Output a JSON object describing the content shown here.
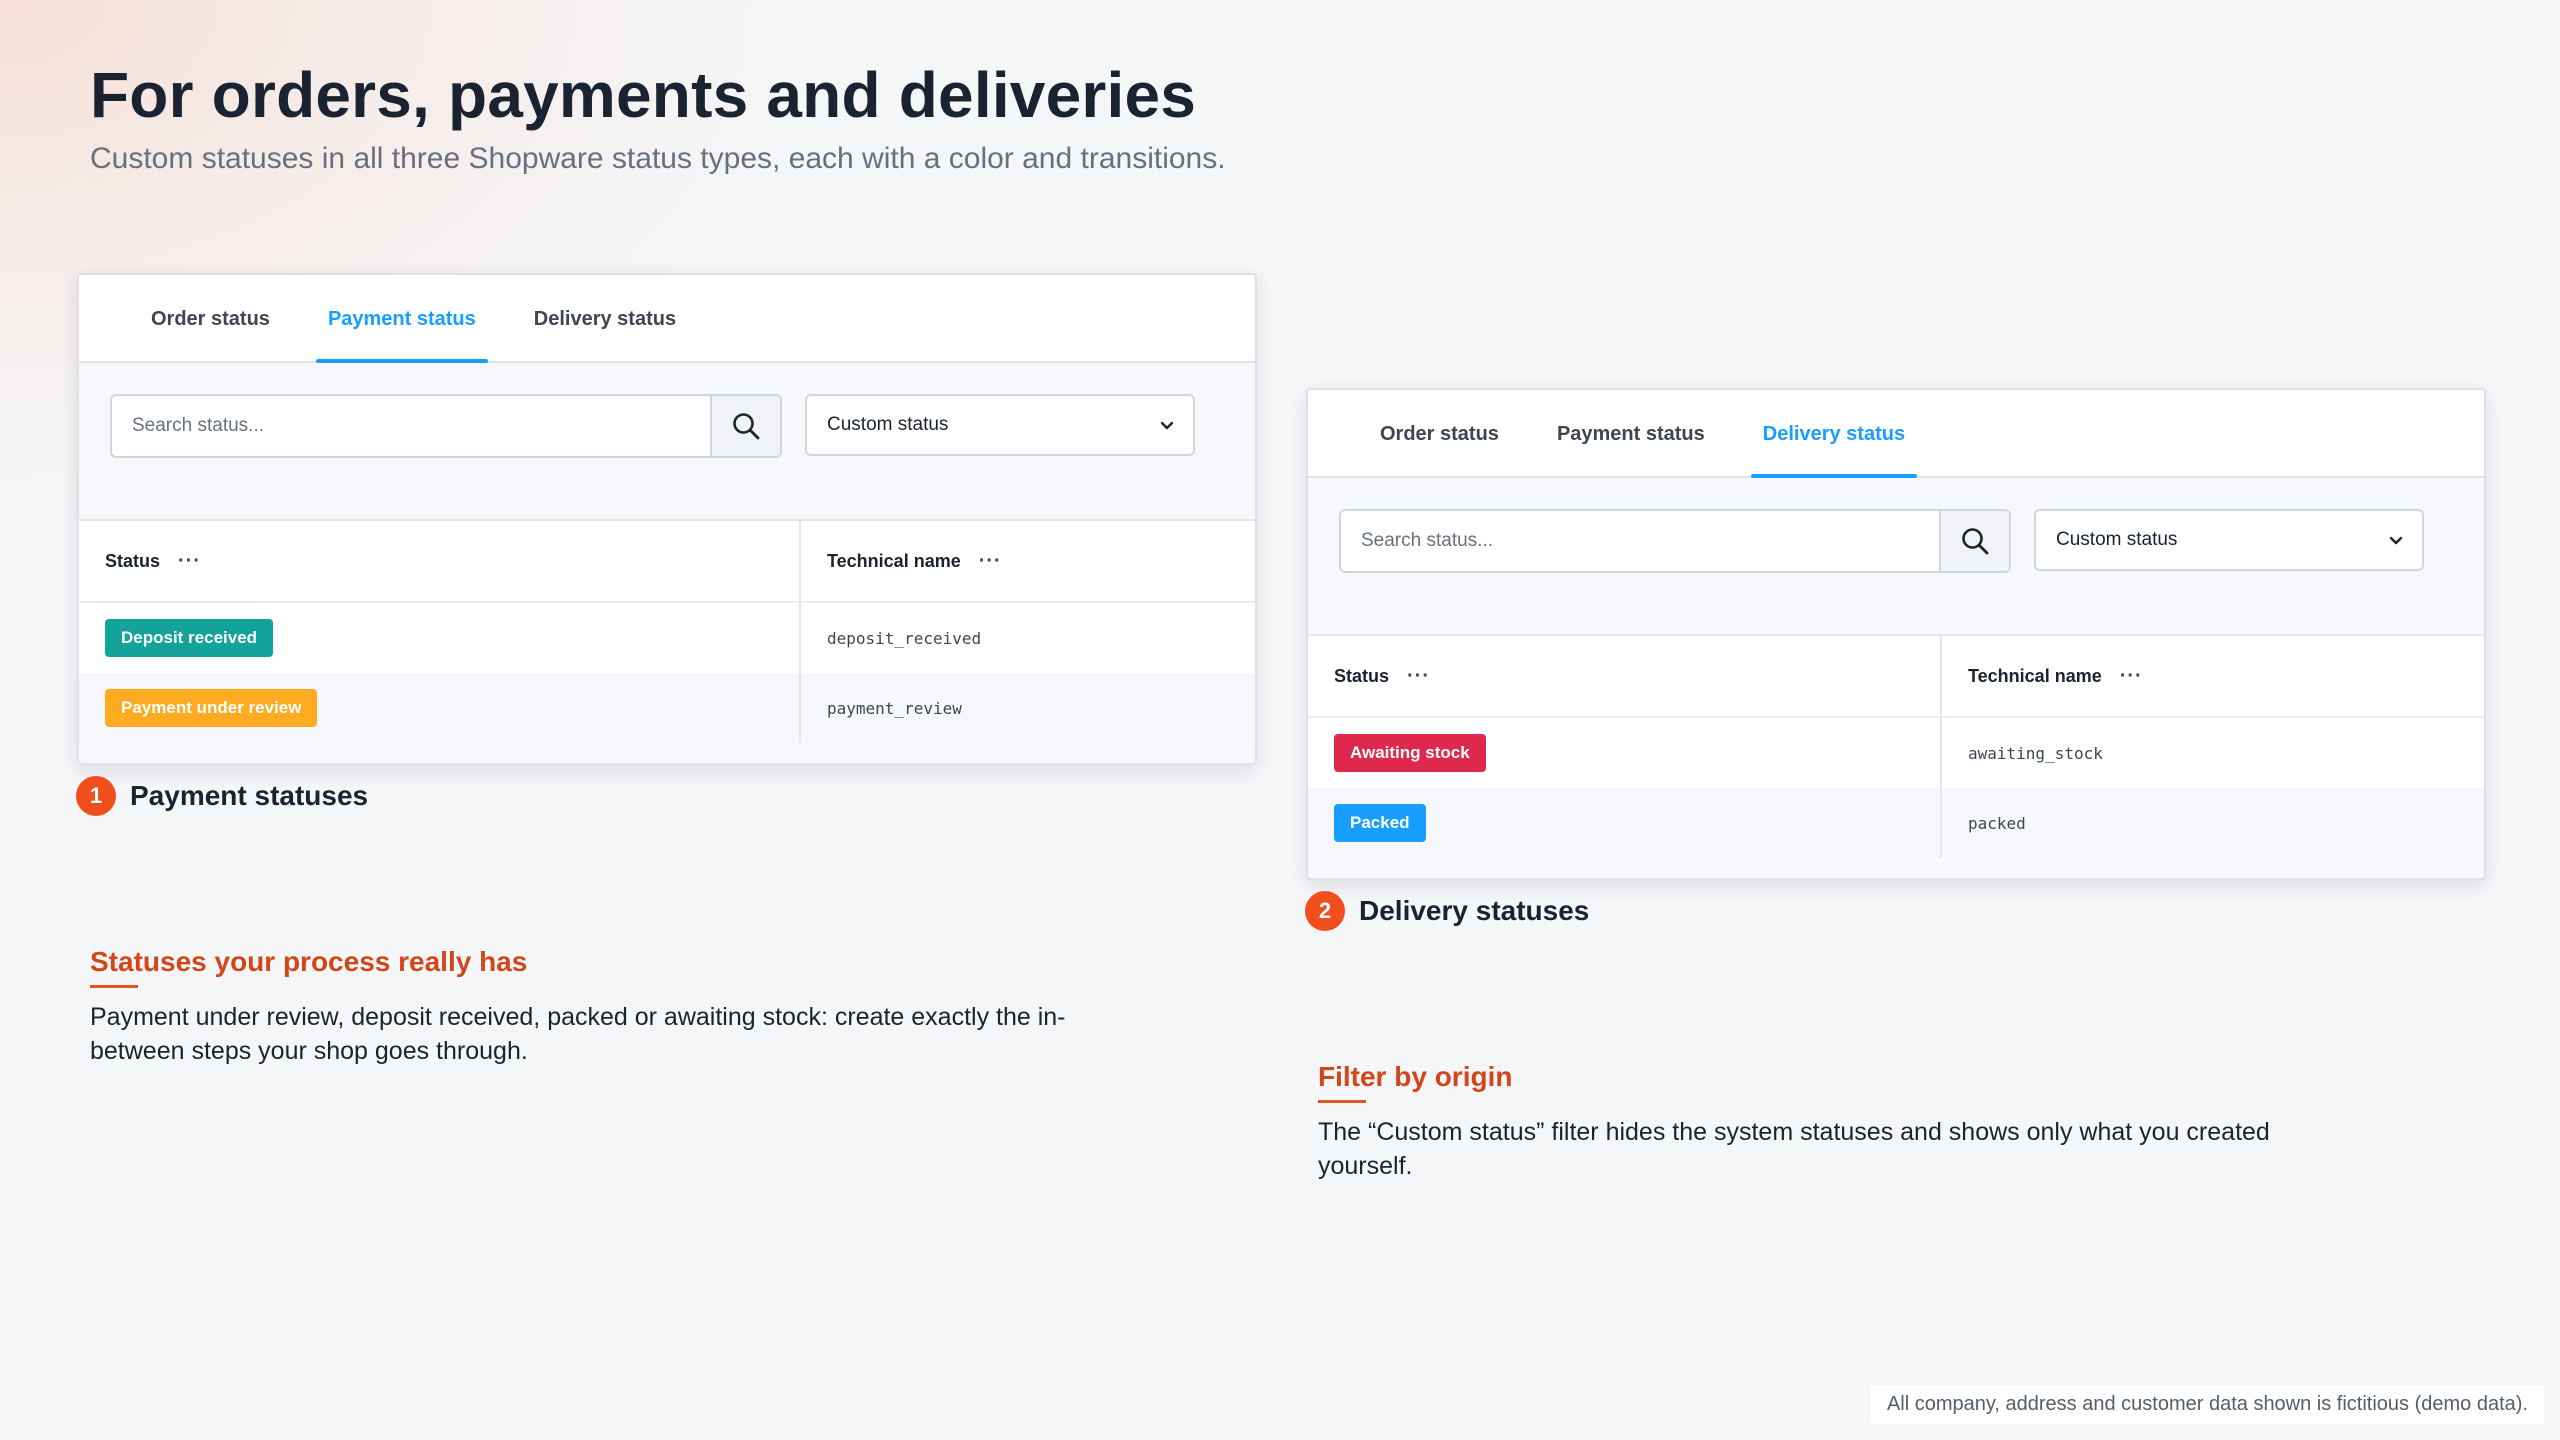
{
  "header": {
    "title": "For orders, payments and deliveries",
    "subtitle": "Custom statuses in all three Shopware status types, each with a color and transitions."
  },
  "panels": [
    {
      "tabs": [
        "Order status",
        "Payment status",
        "Delivery status"
      ],
      "active_tab": "Payment status",
      "search_placeholder": "Search status...",
      "filter_value": "Custom status",
      "columns": [
        "Status",
        "Technical name"
      ],
      "rows": [
        {
          "status": "Deposit received",
          "color": "#13a39a",
          "technical": "deposit_received"
        },
        {
          "status": "Payment under review",
          "color": "#ffab22",
          "technical": "payment_review"
        }
      ],
      "caption_number": "1",
      "caption": "Payment statuses"
    },
    {
      "tabs": [
        "Order status",
        "Payment status",
        "Delivery status"
      ],
      "active_tab": "Delivery status",
      "search_placeholder": "Search status...",
      "filter_value": "Custom status",
      "columns": [
        "Status",
        "Technical name"
      ],
      "rows": [
        {
          "status": "Awaiting stock",
          "color": "#de294c",
          "technical": "awaiting_stock"
        },
        {
          "status": "Packed",
          "color": "#189eff",
          "technical": "packed"
        }
      ],
      "caption_number": "2",
      "caption": "Delivery statuses"
    }
  ],
  "features": [
    {
      "title": "Statuses your process really has",
      "text": "Payment under review, deposit received, packed or awaiting stock: create exactly the in-between steps your shop goes through."
    },
    {
      "title": "Filter by origin",
      "text": "The “Custom status” filter hides the system statuses and shows only what you created yourself."
    }
  ],
  "footnote": "All company, address and customer data shown is fictitious (demo data).",
  "icons": {
    "search": "search-icon",
    "dropdown": "chevron-down-icon",
    "column_menu": "more-dots-icon"
  },
  "colors": {
    "accent_blue": "#189eff",
    "brand_orange": "#f04e1c",
    "feature_title": "#d2461a"
  }
}
